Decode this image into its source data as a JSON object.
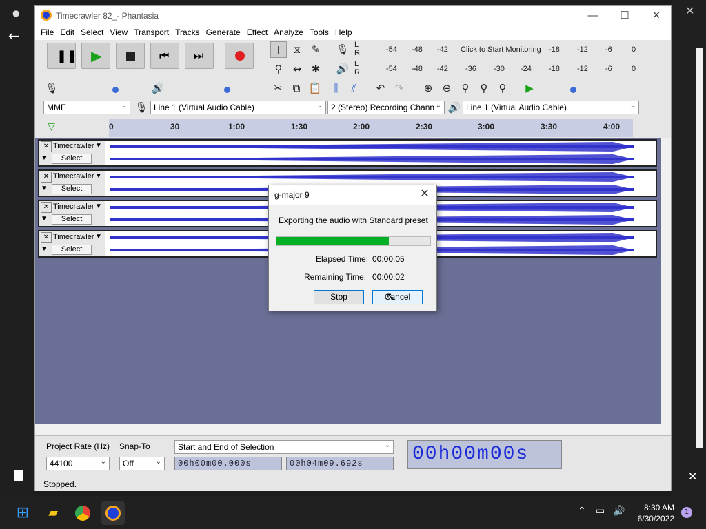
{
  "window": {
    "title": "Timecrawler 82_- Phantasia"
  },
  "menu": [
    "File",
    "Edit",
    "Select",
    "View",
    "Transport",
    "Tracks",
    "Generate",
    "Effect",
    "Analyze",
    "Tools",
    "Help"
  ],
  "meters": {
    "record_ticks": [
      "-54",
      "-48",
      "-42",
      "Click to Start Monitoring",
      "-18",
      "-12",
      "-6",
      "0"
    ],
    "play_ticks": [
      "-54",
      "-48",
      "-42",
      "-36",
      "-30",
      "-24",
      "-18",
      "-12",
      "-6",
      "0"
    ],
    "channel_l": "L",
    "channel_r": "R"
  },
  "devices": {
    "host": "MME",
    "recording_device": "Line 1 (Virtual Audio Cable)",
    "channels": "2 (Stereo) Recording Chann",
    "playback_device": "Line 1 (Virtual Audio Cable)"
  },
  "ruler": {
    "ticks": [
      "0",
      "30",
      "1:00",
      "1:30",
      "2:00",
      "2:30",
      "3:00",
      "3:30",
      "4:00"
    ]
  },
  "tracks": [
    {
      "name": "Timecrawler",
      "select_label": "Select"
    },
    {
      "name": "Timecrawler",
      "select_label": "Select"
    },
    {
      "name": "Timecrawler",
      "select_label": "Select"
    },
    {
      "name": "Timecrawler",
      "select_label": "Select"
    }
  ],
  "selection_toolbar": {
    "project_rate_label": "Project Rate (Hz)",
    "project_rate_value": "44100",
    "snap_to_label": "Snap-To",
    "snap_to_value": "Off",
    "selection_mode": "Start and End of Selection",
    "start_time": "00h00m00.000s",
    "end_time": "00h04m09.692s",
    "big_time": "00h00m00s"
  },
  "status": {
    "text": "Stopped."
  },
  "dialog": {
    "title": "g-major 9",
    "message": "Exporting the audio with Standard preset",
    "progress_percent": 73,
    "elapsed_label": "Elapsed Time:",
    "elapsed_value": "00:00:05",
    "remaining_label": "Remaining Time:",
    "remaining_value": "00:00:02",
    "stop_label": "Stop",
    "cancel_label": "Cancel"
  },
  "taskbar": {
    "time": "8:30 AM",
    "date": "6/30/2022",
    "notification_count": "1"
  },
  "colors": {
    "waveform": "#3333cc",
    "progress": "#06b025",
    "track_bg": "#6a6f95",
    "time_text": "#1b2bd6"
  }
}
